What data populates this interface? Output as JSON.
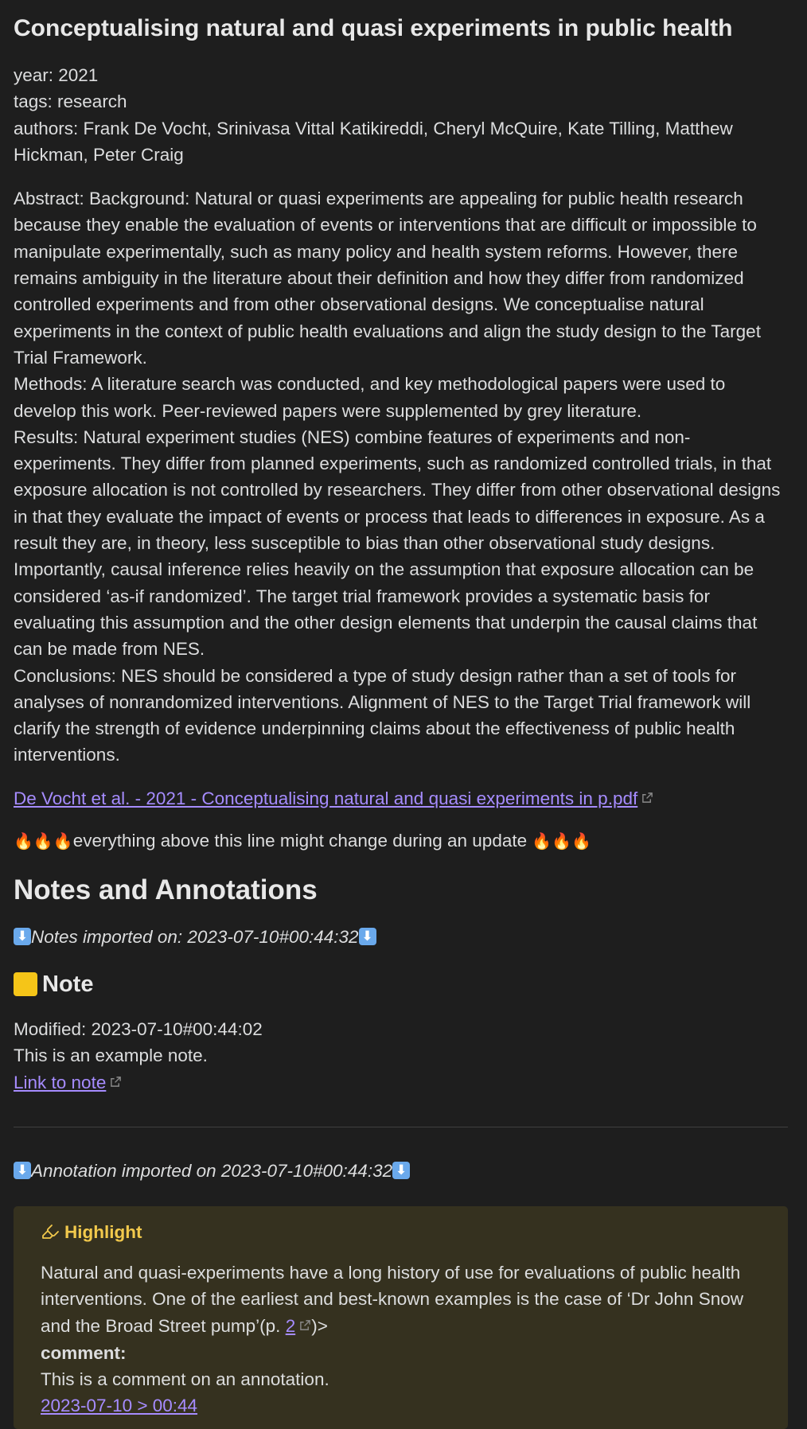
{
  "title": "Conceptualising natural and quasi experiments in public health",
  "properties": {
    "year": "year: 2021",
    "tags": "tags: research",
    "authors": "authors: Frank De Vocht, Srinivasa Vittal Katikireddi, Cheryl McQuire, Kate Tilling, Matthew Hickman, Peter Craig"
  },
  "abstract": {
    "background": "Abstract: Background: Natural or quasi experiments are appealing for public health research because they enable the evaluation of events or interventions that are difficult or impossible to manipulate experimentally, such as many policy and health system reforms. However, there remains ambiguity in the literature about their definition and how they differ from randomized controlled experiments and from other observational designs. We conceptualise natural experiments in the context of public health evaluations and align the study design to the Target Trial Framework.",
    "methods": "Methods: A literature search was conducted, and key methodological papers were used to develop this work. Peer-reviewed papers were supplemented by grey literature.",
    "results": "Results: Natural experiment studies (NES) combine features of experiments and non-experiments. They differ from planned experiments, such as randomized controlled trials, in that exposure allocation is not controlled by researchers. They differ from other observational designs in that they evaluate the impact of events or process that leads to differences in exposure. As a result they are, in theory, less susceptible to bias than other observational study designs. Importantly, causal inference relies heavily on the assumption that exposure allocation can be considered ‘as-if randomized’. The target trial framework provides a systematic basis for evaluating this assumption and the other design elements that underpin the causal claims that can be made from NES.",
    "conclusions": "Conclusions: NES should be considered a type of study design rather than a set of tools for analyses of nonrandomized interventions. Alignment of NES to the Target Trial framework will clarify the strength of evidence underpinning claims about the effectiveness of public health interventions."
  },
  "pdf_link": "De Vocht et al. - 2021 - Conceptualising natural and quasi experiments in p.pdf",
  "warning": {
    "fire_left": "🔥🔥🔥",
    "text": "everything above this line might change during an update ",
    "fire_right": "🔥🔥🔥"
  },
  "notes_heading": "Notes and Annotations",
  "notes_imported": "Notes imported on: 2023-07-10#00:44:32",
  "note": {
    "heading": "Note",
    "modified": "Modified: 2023-07-10#00:44:02",
    "body": "This is an example note.",
    "link": "Link to note"
  },
  "annotation_imported": "Annotation imported on 2023-07-10#00:44:32",
  "highlight": {
    "title": "Highlight",
    "text": "Natural and quasi-experiments have a long history of use for evaluations of public health interventions. One of the earliest and best-known examples is the case of ‘Dr John Snow and the Broad Street pump’(p. ",
    "page_link": "2",
    "text_after": ")>",
    "comment_label": "comment:",
    "comment": "This is a comment on an annotation.",
    "date_link": "2023-07-10 > 00:44"
  },
  "colors": {
    "background": "#1e1e1e",
    "text": "#dcddde",
    "link": "#a68cff",
    "callout_bg": "#35311f",
    "callout_title": "#f2c94c"
  },
  "icons": [
    "external-link-icon",
    "down-arrow-emoji-icon",
    "yellow-square-emoji-icon",
    "highlighter-icon",
    "fire-emoji-icon"
  ]
}
